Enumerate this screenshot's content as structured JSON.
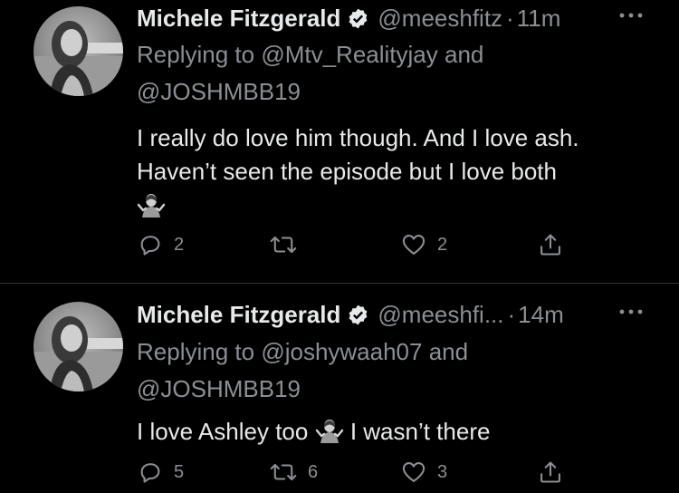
{
  "tweets": [
    {
      "display_name": "Michele Fitzgerald",
      "handle": "@meeshfitz",
      "time": "11m",
      "replying_prefix": "Replying to",
      "replying_first": "@Mtv_Realityjay",
      "replying_and": "and",
      "replying_second": "@JOSHMBB19",
      "text_line1": "I really do love him though. And I love ash.",
      "text_line2": "Haven’t seen the episode but I love both",
      "emoji": "shrug-emoji",
      "replies": "2",
      "retweets": "",
      "likes": "2"
    },
    {
      "display_name": "Michele Fitzgerald",
      "handle": "@meeshfi...",
      "time": "14m",
      "replying_prefix": "Replying to",
      "replying_first": "@joshywaah07",
      "replying_and": "and",
      "replying_second": "@JOSHMBB19",
      "text_before": "I love Ashley too",
      "text_after": "I wasn’t there",
      "emoji": "shrug-emoji",
      "replies": "5",
      "retweets": "6",
      "likes": "3"
    }
  ],
  "icons": {
    "verified": "verified-badge-icon",
    "more": "more-dots-icon",
    "reply": "reply-icon",
    "retweet": "retweet-icon",
    "like": "heart-icon",
    "share": "share-icon"
  },
  "colors": {
    "background": "#000000",
    "primary_text": "#e7e9ea",
    "secondary_text": "#8b8f93",
    "divider": "#2f3336"
  }
}
